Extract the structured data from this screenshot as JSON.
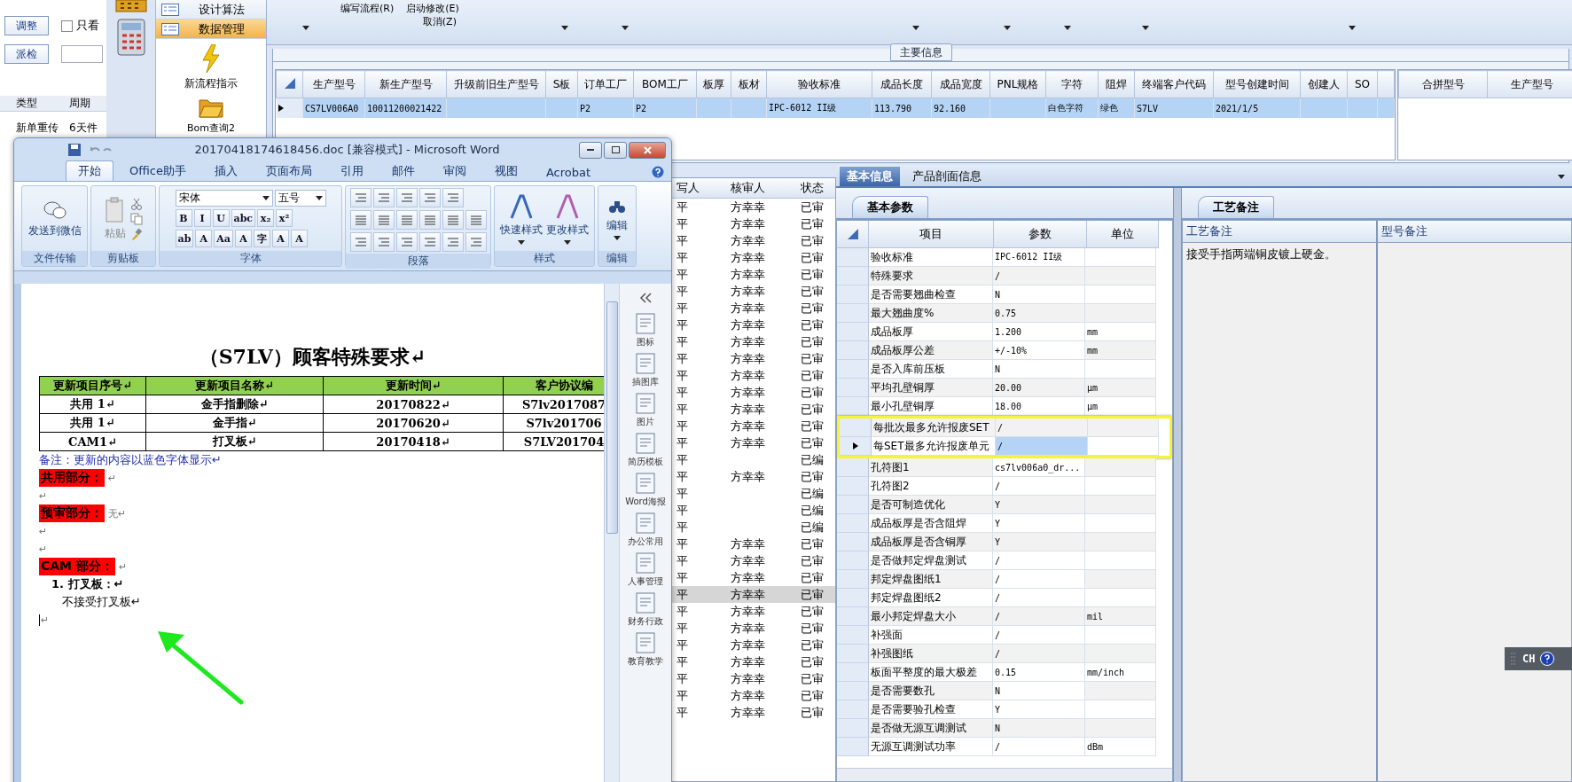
{
  "left_panel": {
    "buttons": [
      "调整",
      "派检"
    ],
    "checkbox": {
      "label": "只看",
      "checked": false
    },
    "list_columns": [
      "类型",
      "周期"
    ],
    "list_rows": [
      [
        "新单重传",
        "6天件"
      ]
    ]
  },
  "nav": {
    "items": [
      {
        "label": "设计算法",
        "selected": false,
        "kind": "row"
      },
      {
        "label": "数据管理",
        "selected": true,
        "kind": "row"
      },
      {
        "label": "新流程指示",
        "selected": false,
        "kind": "lightning"
      },
      {
        "label": "Bom查询2",
        "selected": false,
        "kind": "folder"
      }
    ]
  },
  "toolbar": {
    "items": [
      "编写流程(R)",
      "启动修改(E)",
      "取消(Z)"
    ]
  },
  "main_info": {
    "caption": "主要信息",
    "columns": [
      "生产型号",
      "新生产型号",
      "升级前旧生产型号",
      "S板",
      "订单工厂",
      "BOM工厂",
      "板厚",
      "板材",
      "验收标准",
      "成品长度",
      "成品宽度",
      "PNL规格",
      "字符",
      "阻焊",
      "终端客户代码",
      "型号创建时间",
      "创建人",
      "SO"
    ],
    "rows": [
      {
        "selected": true,
        "cells": [
          "CS7LV006A0",
          "10011200021422",
          "",
          "",
          "P2",
          "P2",
          "",
          "",
          "IPC-6012 II级",
          "113.790",
          "92.160",
          "",
          "白色字符",
          "绿色",
          "S7LV",
          "2021/1/5",
          "",
          ""
        ]
      }
    ],
    "side_columns": [
      "合拼型号",
      "生产型号"
    ]
  },
  "review_list": {
    "columns": [
      "写人",
      "核审人",
      "状态"
    ],
    "rows": [
      {
        "cells": [
          "平",
          "方幸幸",
          "已审"
        ],
        "selected": false
      },
      {
        "cells": [
          "平",
          "方幸幸",
          "已审"
        ],
        "selected": false
      },
      {
        "cells": [
          "平",
          "方幸幸",
          "已审"
        ],
        "selected": false
      },
      {
        "cells": [
          "平",
          "方幸幸",
          "已审"
        ],
        "selected": false
      },
      {
        "cells": [
          "平",
          "方幸幸",
          "已审"
        ],
        "selected": false
      },
      {
        "cells": [
          "平",
          "方幸幸",
          "已审"
        ],
        "selected": false
      },
      {
        "cells": [
          "平",
          "方幸幸",
          "已审"
        ],
        "selected": false
      },
      {
        "cells": [
          "平",
          "方幸幸",
          "已审"
        ],
        "selected": false
      },
      {
        "cells": [
          "平",
          "方幸幸",
          "已审"
        ],
        "selected": false
      },
      {
        "cells": [
          "平",
          "方幸幸",
          "已审"
        ],
        "selected": false
      },
      {
        "cells": [
          "平",
          "方幸幸",
          "已审"
        ],
        "selected": false
      },
      {
        "cells": [
          "平",
          "方幸幸",
          "已审"
        ],
        "selected": false
      },
      {
        "cells": [
          "平",
          "方幸幸",
          "已审"
        ],
        "selected": false
      },
      {
        "cells": [
          "平",
          "方幸幸",
          "已审"
        ],
        "selected": false
      },
      {
        "cells": [
          "平",
          "方幸幸",
          "已审"
        ],
        "selected": false
      },
      {
        "cells": [
          "平",
          "",
          "已编"
        ],
        "selected": false
      },
      {
        "cells": [
          "平",
          "方幸幸",
          "已审"
        ],
        "selected": false
      },
      {
        "cells": [
          "平",
          "",
          "已编"
        ],
        "selected": false
      },
      {
        "cells": [
          "平",
          "",
          "已编"
        ],
        "selected": false
      },
      {
        "cells": [
          "平",
          "",
          "已编"
        ],
        "selected": false
      },
      {
        "cells": [
          "平",
          "方幸幸",
          "已审"
        ],
        "selected": false
      },
      {
        "cells": [
          "平",
          "方幸幸",
          "已审"
        ],
        "selected": false
      },
      {
        "cells": [
          "平",
          "方幸幸",
          "已审"
        ],
        "selected": false
      },
      {
        "cells": [
          "平",
          "方幸幸",
          "已审"
        ],
        "selected": true
      },
      {
        "cells": [
          "平",
          "方幸幸",
          "已审"
        ],
        "selected": false
      },
      {
        "cells": [
          "平",
          "方幸幸",
          "已审"
        ],
        "selected": false
      },
      {
        "cells": [
          "平",
          "方幸幸",
          "已审"
        ],
        "selected": false
      },
      {
        "cells": [
          "平",
          "方幸幸",
          "已审"
        ],
        "selected": false
      },
      {
        "cells": [
          "平",
          "方幸幸",
          "已审"
        ],
        "selected": false
      },
      {
        "cells": [
          "平",
          "方幸幸",
          "已审"
        ],
        "selected": false
      },
      {
        "cells": [
          "平",
          "方幸幸",
          "已审"
        ],
        "selected": false
      }
    ]
  },
  "detail": {
    "tabs": [
      {
        "label": "基本信息",
        "selected": true
      },
      {
        "label": "产品剖面信息",
        "selected": false
      }
    ],
    "subtab": "基本参数",
    "columns": [
      "项目",
      "参数",
      "单位"
    ],
    "rows": [
      {
        "name": "验收标准",
        "value": "IPC-6012 II级",
        "unit": "",
        "selected": false
      },
      {
        "name": "特殊要求",
        "value": "/",
        "unit": "",
        "selected": false
      },
      {
        "name": "是否需要翘曲检查",
        "value": "N",
        "unit": "",
        "selected": false
      },
      {
        "name": "最大翘曲度%",
        "value": "0.75",
        "unit": "",
        "selected": false
      },
      {
        "name": "成品板厚",
        "value": "1.200",
        "unit": "mm",
        "selected": false
      },
      {
        "name": "成品板厚公差",
        "value": "+/-10%",
        "unit": "mm",
        "selected": false
      },
      {
        "name": "是否入库前压板",
        "value": "N",
        "unit": "",
        "selected": false
      },
      {
        "name": "平均孔壁铜厚",
        "value": "20.00",
        "unit": "μm",
        "selected": false
      },
      {
        "name": "最小孔壁铜厚",
        "value": "18.00",
        "unit": "μm",
        "selected": false
      },
      {
        "name": "每批次最多允许报废SET",
        "value": "/",
        "unit": "",
        "selected": false,
        "highlighted": true
      },
      {
        "name": "每SET最多允许报废单元",
        "value": "/",
        "unit": "",
        "selected": true,
        "highlighted": true
      },
      {
        "name": "孔符图1",
        "value": "cs7lv006a0_dr...",
        "unit": "",
        "selected": false
      },
      {
        "name": "孔符图2",
        "value": "/",
        "unit": "",
        "selected": false
      },
      {
        "name": "是否可制造优化",
        "value": "Y",
        "unit": "",
        "selected": false
      },
      {
        "name": "成品板厚是否含阻焊",
        "value": "Y",
        "unit": "",
        "selected": false
      },
      {
        "name": "成品板厚是否含铜厚",
        "value": "Y",
        "unit": "",
        "selected": false
      },
      {
        "name": "是否做邦定焊盘测试",
        "value": "/",
        "unit": "",
        "selected": false
      },
      {
        "name": "邦定焊盘图纸1",
        "value": "/",
        "unit": "",
        "selected": false
      },
      {
        "name": "邦定焊盘图纸2",
        "value": "/",
        "unit": "",
        "selected": false
      },
      {
        "name": "最小邦定焊盘大小",
        "value": "/",
        "unit": "mil",
        "selected": false
      },
      {
        "name": "补强面",
        "value": "/",
        "unit": "",
        "selected": false
      },
      {
        "name": "补强图纸",
        "value": "/",
        "unit": "",
        "selected": false
      },
      {
        "name": "板面平整度的最大极差",
        "value": "0.15",
        "unit": "mm/inch",
        "selected": false
      },
      {
        "name": "是否需要数孔",
        "value": "N",
        "unit": "",
        "selected": false
      },
      {
        "name": "是否需要验孔检查",
        "value": "Y",
        "unit": "",
        "selected": false
      },
      {
        "name": "是否做无源互调测试",
        "value": "N",
        "unit": "",
        "selected": false
      },
      {
        "name": "无源互调测试功率",
        "value": "/",
        "unit": "dBm",
        "selected": false
      }
    ]
  },
  "notes": {
    "tab": "工艺备注",
    "columns": [
      "工艺备注",
      "型号备注"
    ],
    "process_note": "接受手指两端铜皮镀上硬金。"
  },
  "word": {
    "title": "20170418174618456.doc [兼容模式] - Microsoft Word",
    "tabs": [
      {
        "label": "开始",
        "selected": true
      },
      {
        "label": "Office助手",
        "selected": false
      },
      {
        "label": "插入",
        "selected": false
      },
      {
        "label": "页面布局",
        "selected": false
      },
      {
        "label": "引用",
        "selected": false
      },
      {
        "label": "邮件",
        "selected": false
      },
      {
        "label": "审阅",
        "selected": false
      },
      {
        "label": "视图",
        "selected": false
      },
      {
        "label": "Acrobat",
        "selected": false
      }
    ],
    "groups": [
      "文件传输",
      "剪贴板",
      "字体",
      "段落",
      "样式",
      "编辑"
    ],
    "send_wechat": "发送到微信",
    "paste": "粘贴",
    "font": "宋体",
    "size": "五号",
    "font_row1": [
      "B",
      "I",
      "U",
      "abc",
      "x₂",
      "x²"
    ],
    "font_row2": [
      "ab",
      "A",
      "Aa",
      "A",
      "字",
      "A",
      "A"
    ],
    "styles": [
      "快速样式",
      "更改样式"
    ],
    "edit": "编辑",
    "side_panel": [
      "图标",
      "插图库",
      "图片",
      "简历模板",
      "Word海报",
      "办公常用",
      "人事管理",
      "财务行政",
      "教育教学"
    ],
    "doc_title": "（S7LV）顾客特殊要求↵",
    "table_columns": [
      "更新项目序号↵",
      "更新项目名称↵",
      "更新时间↵",
      "客户协议编"
    ],
    "table_rows": [
      [
        "共用 1↵",
        "金手指删除↵",
        "20170822↵",
        "S7lv2017087"
      ],
      [
        "共用 1↵",
        "金手指↵",
        "20170620↵",
        "S7lv201706"
      ],
      [
        "CAM1↵",
        "打叉板↵",
        "20170418↵",
        "S7LV201704"
      ]
    ],
    "paragraphs": [
      {
        "kind": "note",
        "text": "备注：更新的内容以蓝色字体显示↵"
      },
      {
        "kind": "section",
        "text": "共用部分：",
        "tail": "↵"
      },
      {
        "kind": "blank",
        "text": "↵"
      },
      {
        "kind": "section",
        "text": "预审部分：",
        "tail": "无↵"
      },
      {
        "kind": "blank",
        "text": "↵"
      },
      {
        "kind": "blank",
        "text": "↵"
      },
      {
        "kind": "section",
        "text": "CAM 部分：",
        "tail": "↵"
      },
      {
        "kind": "item",
        "number": "1.",
        "text": "打叉板：↵"
      },
      {
        "kind": "body",
        "text": "不接受打叉板↵"
      },
      {
        "kind": "cursor",
        "text": "↵"
      }
    ]
  },
  "language_bar": {
    "text": "CH"
  }
}
